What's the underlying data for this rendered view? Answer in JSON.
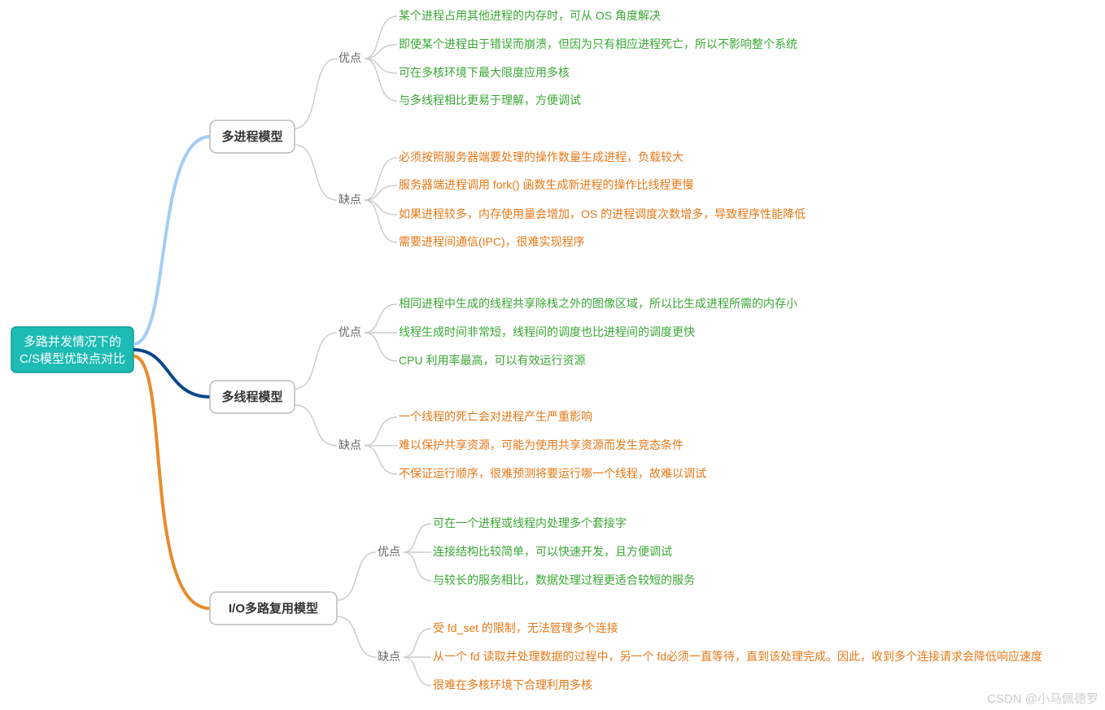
{
  "chart_data": {
    "type": "mindmap",
    "root": "多路并发情况下的\nC/S模型优缺点对比",
    "l2_adv_label": "优点",
    "l2_dis_label": "缺点",
    "branches": [
      {
        "name": "多进程模型",
        "advantages": [
          "某个进程占用其他进程的内存时，可从 OS 角度解决",
          "即使某个进程由于错误而崩溃，但因为只有相应进程死亡，所以不影响整个系统",
          "可在多核环境下最大限度应用多核",
          "与多线程相比更易于理解，方便调试"
        ],
        "disadvantages": [
          "必须按照服务器端要处理的操作数量生成进程，负载较大",
          "服务器端进程调用 fork() 函数生成新进程的操作比线程更慢",
          "如果进程较多，内存使用量会增加，OS 的进程调度次数增多，导致程序性能降低",
          "需要进程间通信(IPC)，很难实现程序"
        ]
      },
      {
        "name": "多线程模型",
        "advantages": [
          "相同进程中生成的线程共享除栈之外的图像区域，所以比生成进程所需的内存小",
          "线程生成时间非常短，线程间的调度也比进程间的调度更快",
          "CPU 利用率最高，可以有效运行资源"
        ],
        "disadvantages": [
          "一个线程的死亡会对进程产生严重影响",
          "难以保护共享资源，可能为使用共享资源而发生竞态条件",
          "不保证运行顺序，很难预测将要运行哪一个线程，故难以调试"
        ]
      },
      {
        "name": "I/O多路复用模型",
        "advantages": [
          "可在一个进程或线程内处理多个套接字",
          "连接结构比较简单，可以快速开发，且方便调试",
          "与较长的服务相比，数据处理过程更适合较短的服务"
        ],
        "disadvantages": [
          "受 fd_set 的限制，无法管理多个连接",
          "从一个 fd 读取并处理数据的过程中，另一个 fd必须一直等待，直到该处理完成。因此，收到多个连接请求会降低响应速度",
          "很难在多核环境下合理利用多核"
        ]
      }
    ]
  },
  "watermark": "CSDN @小马佩德罗"
}
